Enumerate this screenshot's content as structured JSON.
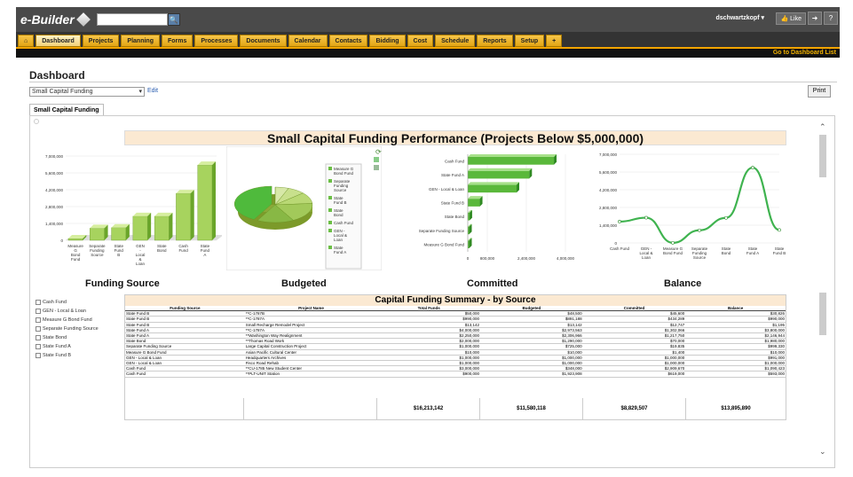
{
  "app": {
    "logo": "e-Builder",
    "user": "dschwartzkopf",
    "like_label": "Like"
  },
  "tabs": [
    "Dashboard",
    "Projects",
    "Planning",
    "Forms",
    "Processes",
    "Documents",
    "Calendar",
    "Contacts",
    "Bidding",
    "Cost",
    "Schedule",
    "Reports",
    "Setup",
    "+"
  ],
  "goto_label": "Go to Dashboard List",
  "page_title": "Dashboard",
  "selector": {
    "value": "Small Capital Funding",
    "edit_label": "Edit"
  },
  "print_label": "Print",
  "subtab_label": "Small Capital Funding",
  "performance_title": "Small Capital Funding Performance (Projects Below $5,000,000)",
  "chart_titles": [
    "Funding Source",
    "Budgeted",
    "Committed",
    "Balance"
  ],
  "summary_title": "Capital Funding Summary - by Source",
  "filters": [
    "Cash Fund",
    "GEN - Local & Loan",
    "Measure G Bond Fund",
    "Separate Funding Source",
    "State Bond",
    "State Fund A",
    "State Fund B"
  ],
  "columns": [
    "Funding Source",
    "Project Name",
    "Total Funds",
    "Budgeted",
    "Committed",
    "Balance"
  ],
  "rows": [
    [
      "State Fund B",
      "**C-1787B",
      "$50,000",
      "$48,500",
      "$45,600",
      "$30,826"
    ],
    [
      "State Fund B",
      "**C-1787A",
      "$990,000",
      "$891,188",
      "$434,289",
      "$990,000"
    ],
    [
      "State Fund B",
      "Small Recharge Remodel Project",
      "$13,142",
      "$13,142",
      "$12,747",
      "$1,195"
    ],
    [
      "State Fund A",
      "**C-1787A",
      "$4,000,000",
      "$2,973,563",
      "$1,302,066",
      "$3,800,000"
    ],
    [
      "State Fund A",
      "**Washington Way Realignment",
      "$2,250,000",
      "$2,306,966",
      "$1,217,750",
      "$2,146,944"
    ],
    [
      "State Bond",
      "**Thomas Road Work",
      "$2,000,000",
      "$1,290,000",
      "$70,000",
      "$1,980,000"
    ],
    [
      "Separate Funding Source",
      "Large Capital Construction Project",
      "$1,000,000",
      "$725,000",
      "$19,835",
      "$999,330"
    ],
    [
      "Measure G Bond Fund",
      "Asian Pacific Cultural Center",
      "$10,000",
      "$10,000",
      "$1,400",
      "$10,000"
    ],
    [
      "GEN - Local & Loan",
      "Headquarters Archives",
      "$1,000,000",
      "$1,000,000",
      "$1,000,000",
      "$991,000"
    ],
    [
      "GEN - Local & Loan",
      "Fisco Road Rehab",
      "$1,000,000",
      "$1,000,000",
      "$1,000,000",
      "$1,000,000"
    ],
    [
      "Cash Fund",
      "**CU-1785 New Student Center",
      "$3,000,000",
      "$348,000",
      "$2,909,670",
      "$1,090,423"
    ],
    [
      "Cash Fund",
      "**PLT-UNIT Station",
      "$900,000",
      "$1,923,908",
      "$619,000",
      "$593,000"
    ]
  ],
  "totals": [
    "",
    "",
    "$16,213,142",
    "$11,580,118",
    "$8,829,507",
    "$13,895,890"
  ],
  "chart_data": [
    {
      "type": "bar",
      "name": "Funding Source",
      "categories": [
        "Measure G Bond Fund",
        "Separate Funding Source",
        "State Fund B",
        "GEN - Local & Loan",
        "State Bond",
        "Cash Fund",
        "State Fund A"
      ],
      "values": [
        10000,
        1000000,
        1053142,
        2000000,
        2000000,
        3900000,
        6250000
      ],
      "ylim": [
        0,
        7000000
      ],
      "yticks": [
        "0",
        "1,400,000",
        "2,800,000",
        "4,200,000",
        "5,600,000",
        "7,000,000"
      ]
    },
    {
      "type": "pie",
      "name": "Budgeted",
      "legend": [
        "Measure G Bond Fund",
        "Separate Funding Source",
        "State Fund B",
        "State Bond",
        "Cash Fund",
        "GEN - Local & Loan",
        "State Fund A"
      ],
      "values": [
        10000,
        725000,
        952830,
        1290000,
        2271908,
        2000000,
        5280529
      ]
    },
    {
      "type": "bar",
      "name": "Committed",
      "orientation": "horizontal",
      "categories": [
        "Cash Fund",
        "State Fund A",
        "GEN - Local & Loan",
        "State Fund B",
        "State Bond",
        "Separate Funding Source",
        "Measure G Bond Fund"
      ],
      "values": [
        3528670,
        2519816,
        2000000,
        492636,
        70000,
        19835,
        1400
      ],
      "xlim": [
        0,
        4000000
      ],
      "xticks": [
        "0",
        "800,000",
        "2,400,000",
        "4,000,000"
      ]
    },
    {
      "type": "line",
      "name": "Balance",
      "categories": [
        "Cash Fund",
        "GEN - Local & Loan",
        "Measure G Bond Fund",
        "Separate Funding Source",
        "State Bond",
        "State Fund A",
        "State Fund B"
      ],
      "values": [
        1683423,
        1991000,
        10000,
        999330,
        1980000,
        5946944,
        1022021
      ],
      "ylim": [
        0,
        7000000
      ],
      "yticks": [
        "0",
        "1,400,000",
        "2,800,000",
        "4,200,000",
        "5,600,000",
        "7,000,000"
      ]
    }
  ],
  "colors": {
    "bar_light": "#bfe08a",
    "bar_dark": "#6aa52a",
    "highlight": "#37b037",
    "banner": "#fbe9d2",
    "tab": "#f2b030"
  }
}
